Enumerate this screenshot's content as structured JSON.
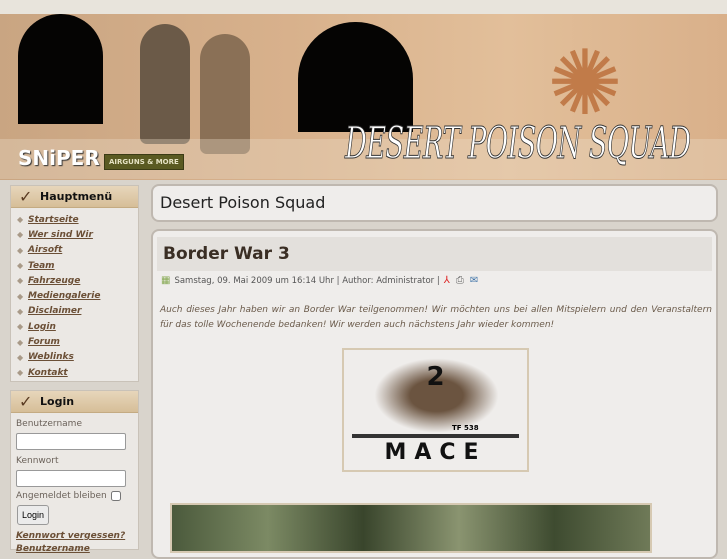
{
  "header": {
    "site_title": "DESERT POISON SQUAD",
    "sponsor_logo": "SNiPER",
    "sponsor_tagline": "AIRGUNS & MORE"
  },
  "sidebar": {
    "main_menu": {
      "title": "Hauptmenü",
      "items": [
        "Startseite",
        "Wer sind Wir",
        "Airsoft",
        "Team",
        "Fahrzeuge",
        "Mediengalerie",
        "Disclaimer",
        "Login",
        "Forum",
        "Weblinks",
        "Kontakt"
      ]
    },
    "login": {
      "title": "Login",
      "username_label": "Benutzername",
      "password_label": "Kennwort",
      "remember_label": "Angemeldet bleiben",
      "button": "Login",
      "forgot_password": "Kennwort vergessen?",
      "forgot_username": "Benutzername"
    }
  },
  "main": {
    "page_heading": "Desert Poison Squad",
    "article": {
      "title": "Border War 3",
      "meta": "Samstag, 09. Mai 2009 um 16:14 Uhr | Author: Administrator |",
      "body": "Auch dieses Jahr haben wir an Border War teilgenommen! Wir möchten uns bei allen Mitspielern und den Veranstaltern für das tolle Wochenende bedanken! Wir werden auch nächstens Jahr wieder kommen!",
      "image_text": {
        "number": "2",
        "name": "MACE",
        "tag": "TF 538"
      }
    }
  }
}
